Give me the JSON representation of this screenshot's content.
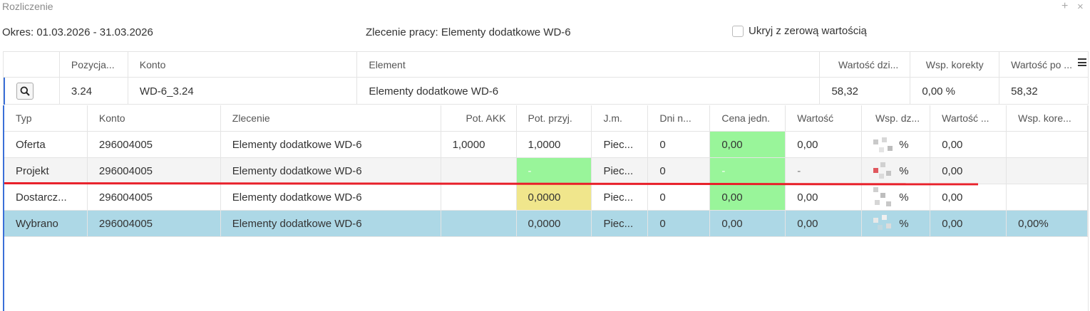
{
  "window": {
    "title": "Rozliczenie",
    "plus_label": "+",
    "close_label": "×"
  },
  "info": {
    "period": "Okres: 01.03.2026 - 31.03.2026",
    "order": "Zlecenie pracy: Elementy dodatkowe WD-6",
    "hide_zero_label": "Ukryj z zerową wartością",
    "hide_zero_checked": false
  },
  "top_grid": {
    "headers": [
      "",
      "Pozycja...",
      "Konto",
      "Element",
      "Wartość dzi...",
      "Wsp. korekty",
      "Wartość po ..."
    ],
    "row": {
      "pozycja": "3.24",
      "konto": "WD-6_3.24",
      "element": "Elementy dodatkowe WD-6",
      "wartosc_dzi": "58,32",
      "wsp_korekty": "0,00 %",
      "wartosc_po": "58,32"
    }
  },
  "detail_grid": {
    "headers": [
      "Typ",
      "Konto",
      "Zlecenie",
      "Pot. AKK",
      "Pot. przyj.",
      "J.m.",
      "Dni n...",
      "Cena jedn.",
      "Wartość",
      "Wsp. dz...",
      "Wartość ...",
      "Wsp. kore..."
    ],
    "rows": [
      {
        "typ": "Oferta",
        "konto": "296004005",
        "zlecenie": "Elementy dodatkowe WD-6",
        "pot_akk": "1,0000",
        "pot_przyj": "1,0000",
        "jm": "Piec...",
        "dni": "0",
        "cena": "0,00",
        "wartosc": "0,00",
        "wsp_dz": "%",
        "wartosc2": "0,00",
        "wsp_kore": ""
      },
      {
        "typ": "Projekt",
        "konto": "296004005",
        "zlecenie": "Elementy dodatkowe WD-6",
        "pot_akk": "",
        "pot_przyj": "-",
        "jm": "Piec...",
        "dni": "0",
        "cena": "-",
        "wartosc": "-",
        "wsp_dz": "%",
        "wartosc2": "0,00",
        "wsp_kore": ""
      },
      {
        "typ": "Dostarcz...",
        "konto": "296004005",
        "zlecenie": "Elementy dodatkowe WD-6",
        "pot_akk": "",
        "pot_przyj": "0,0000",
        "jm": "Piec...",
        "dni": "0",
        "cena": "0,00",
        "wartosc": "0,00",
        "wsp_dz": "%",
        "wartosc2": "0,00",
        "wsp_kore": ""
      },
      {
        "typ": "Wybrano",
        "konto": "296004005",
        "zlecenie": "Elementy dodatkowe WD-6",
        "pot_akk": "",
        "pot_przyj": "0,0000",
        "jm": "Piec...",
        "dni": "0",
        "cena": "0,00",
        "wartosc": "0,00",
        "wsp_dz": "%",
        "wartosc2": "0,00",
        "wsp_kore": "0,00%"
      }
    ]
  },
  "colors": {
    "accent": "#3a6fd8",
    "green_cell": "#99f59a",
    "yellow_cell": "#f0e68c",
    "selected_row": "#add8e6",
    "annotation_line": "#e8202a"
  },
  "icons": [
    "search-icon",
    "menu-icon",
    "plus-icon",
    "close-icon"
  ]
}
